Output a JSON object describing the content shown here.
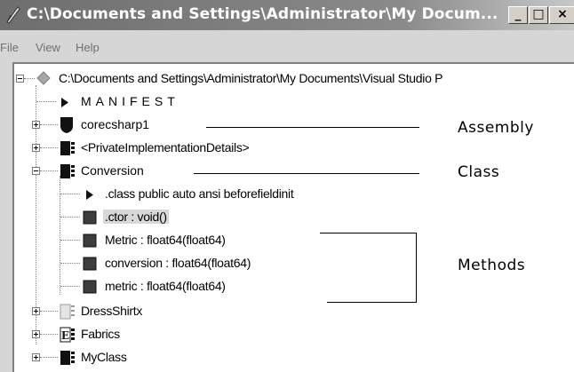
{
  "window": {
    "title": "C:\\Documents and Settings\\Administrator\\My Docum...",
    "controls": {
      "minimize": "_",
      "maximize": "□",
      "close": "×"
    }
  },
  "menu": [
    "File",
    "View",
    "Help"
  ],
  "tree": {
    "root": "C:\\Documents and Settings\\Administrator\\My Documents\\Visual Studio P",
    "manifest": "MANIFEST",
    "assembly": "corecsharp1",
    "private_impl": "<PrivateImplementationDetails>",
    "class_node": "Conversion",
    "class_decl": ".class public auto ansi beforefieldinit",
    "ctor": ".ctor : void()",
    "method_1": "Metric : float64(float64)",
    "method_2": "conversion : float64(float64)",
    "method_3": "metric : float64(float64)",
    "dress_shirtx": "DressShirtx",
    "fabrics": "Fabrics",
    "myclass": "MyClass"
  },
  "annotations": {
    "assembly": "Assembly",
    "class": "Class",
    "methods": "Methods"
  },
  "icons": {
    "root": "assembly-root-diamond-icon",
    "manifest": "manifest-triangle-icon",
    "assembly": "shield-icon",
    "class": "class-icon",
    "method": "method-square-icon",
    "enum": "enum-icon",
    "interface": "interface-icon"
  }
}
